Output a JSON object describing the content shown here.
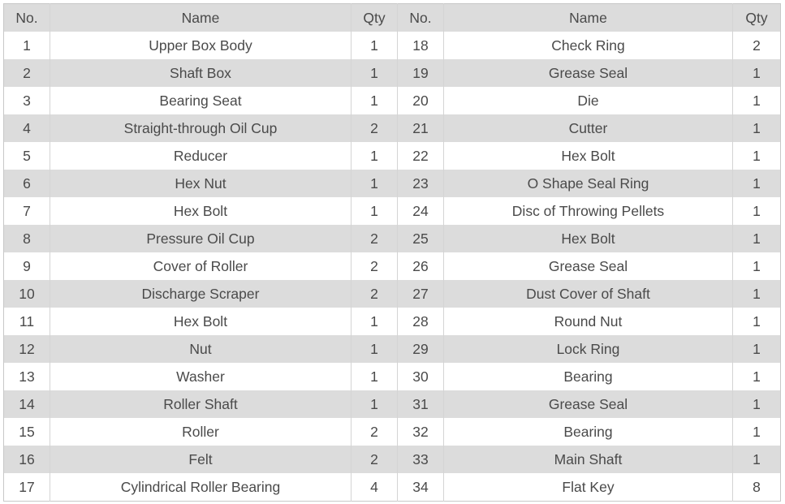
{
  "table": {
    "headers": [
      "No.",
      "Name",
      "Qty",
      "No.",
      "Name",
      "Qty"
    ],
    "rows": [
      [
        "1",
        "Upper Box Body",
        "1",
        "18",
        "Check Ring",
        "2"
      ],
      [
        "2",
        "Shaft Box",
        "1",
        "19",
        "Grease Seal",
        "1"
      ],
      [
        "3",
        "Bearing Seat",
        "1",
        "20",
        "Die",
        "1"
      ],
      [
        "4",
        "Straight-through Oil Cup",
        "2",
        "21",
        "Cutter",
        "1"
      ],
      [
        "5",
        "Reducer",
        "1",
        "22",
        "Hex Bolt",
        "1"
      ],
      [
        "6",
        "Hex Nut",
        "1",
        "23",
        "O Shape Seal Ring",
        "1"
      ],
      [
        "7",
        "Hex Bolt",
        "1",
        "24",
        "Disc of Throwing Pellets",
        "1"
      ],
      [
        "8",
        "Pressure Oil Cup",
        "2",
        "25",
        "Hex Bolt",
        "1"
      ],
      [
        "9",
        "Cover of Roller",
        "2",
        "26",
        "Grease Seal",
        "1"
      ],
      [
        "10",
        "Discharge Scraper",
        "2",
        "27",
        "Dust Cover of Shaft",
        "1"
      ],
      [
        "11",
        "Hex Bolt",
        "1",
        "28",
        "Round Nut",
        "1"
      ],
      [
        "12",
        "Nut",
        "1",
        "29",
        "Lock Ring",
        "1"
      ],
      [
        "13",
        "Washer",
        "1",
        "30",
        "Bearing",
        "1"
      ],
      [
        "14",
        "Roller Shaft",
        "1",
        "31",
        "Grease Seal",
        "1"
      ],
      [
        "15",
        "Roller",
        "2",
        "32",
        "Bearing",
        "1"
      ],
      [
        "16",
        "Felt",
        "2",
        "33",
        "Main Shaft",
        "1"
      ],
      [
        "17",
        "Cylindrical Roller Bearing",
        "4",
        "34",
        "Flat Key",
        "8"
      ]
    ]
  },
  "colors": {
    "header_bg": "#dcdcdc",
    "row_alt_bg": "#dcdcdc",
    "row_bg": "#ffffff",
    "text": "#4a4a4a",
    "border": "#c8c8c8"
  }
}
